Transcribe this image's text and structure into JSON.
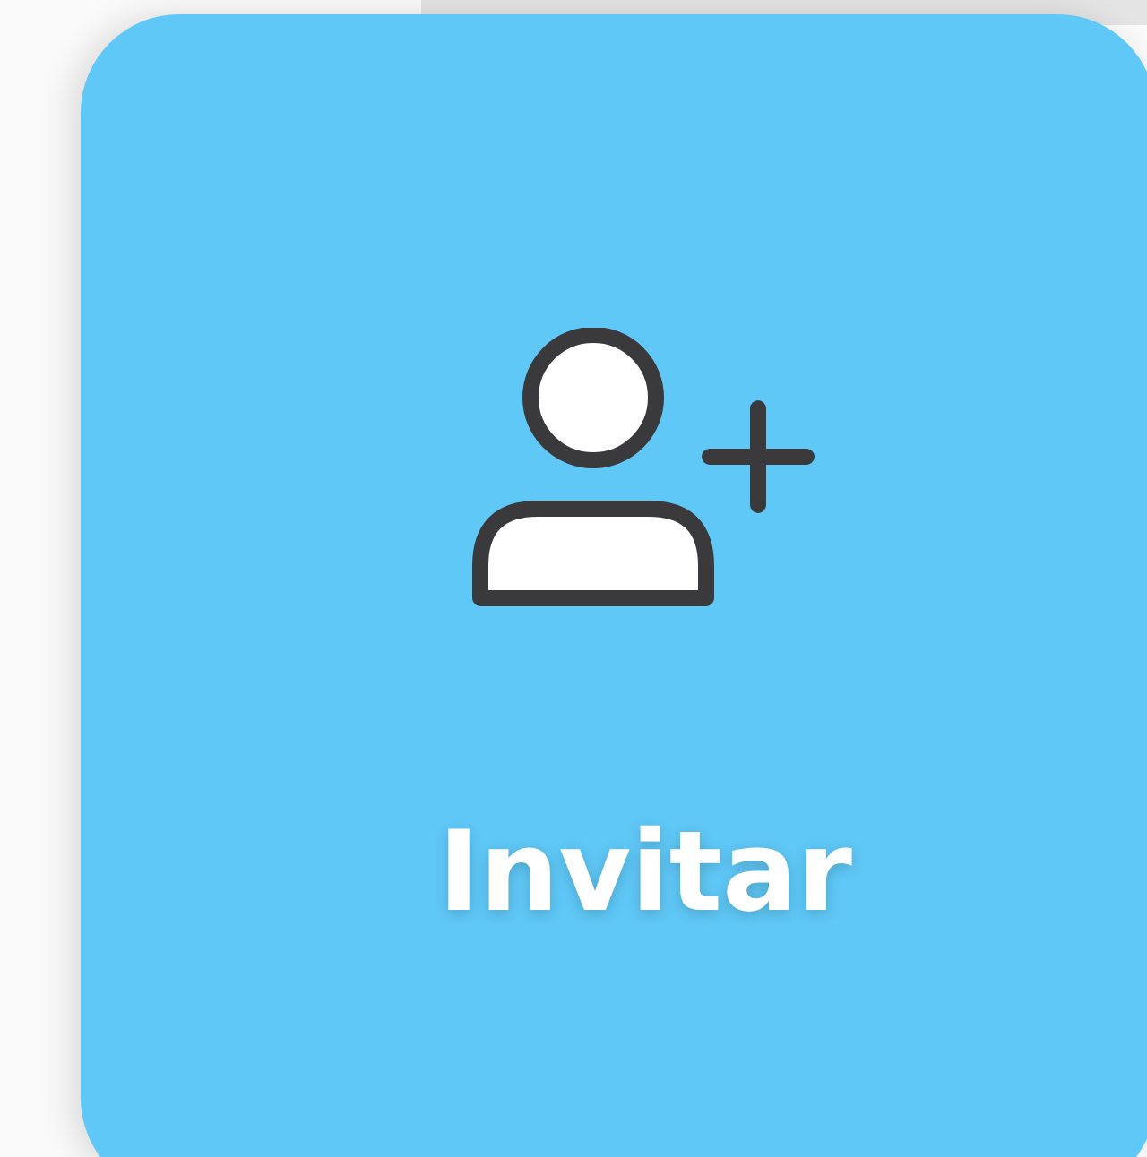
{
  "card": {
    "label": "Invitar"
  }
}
